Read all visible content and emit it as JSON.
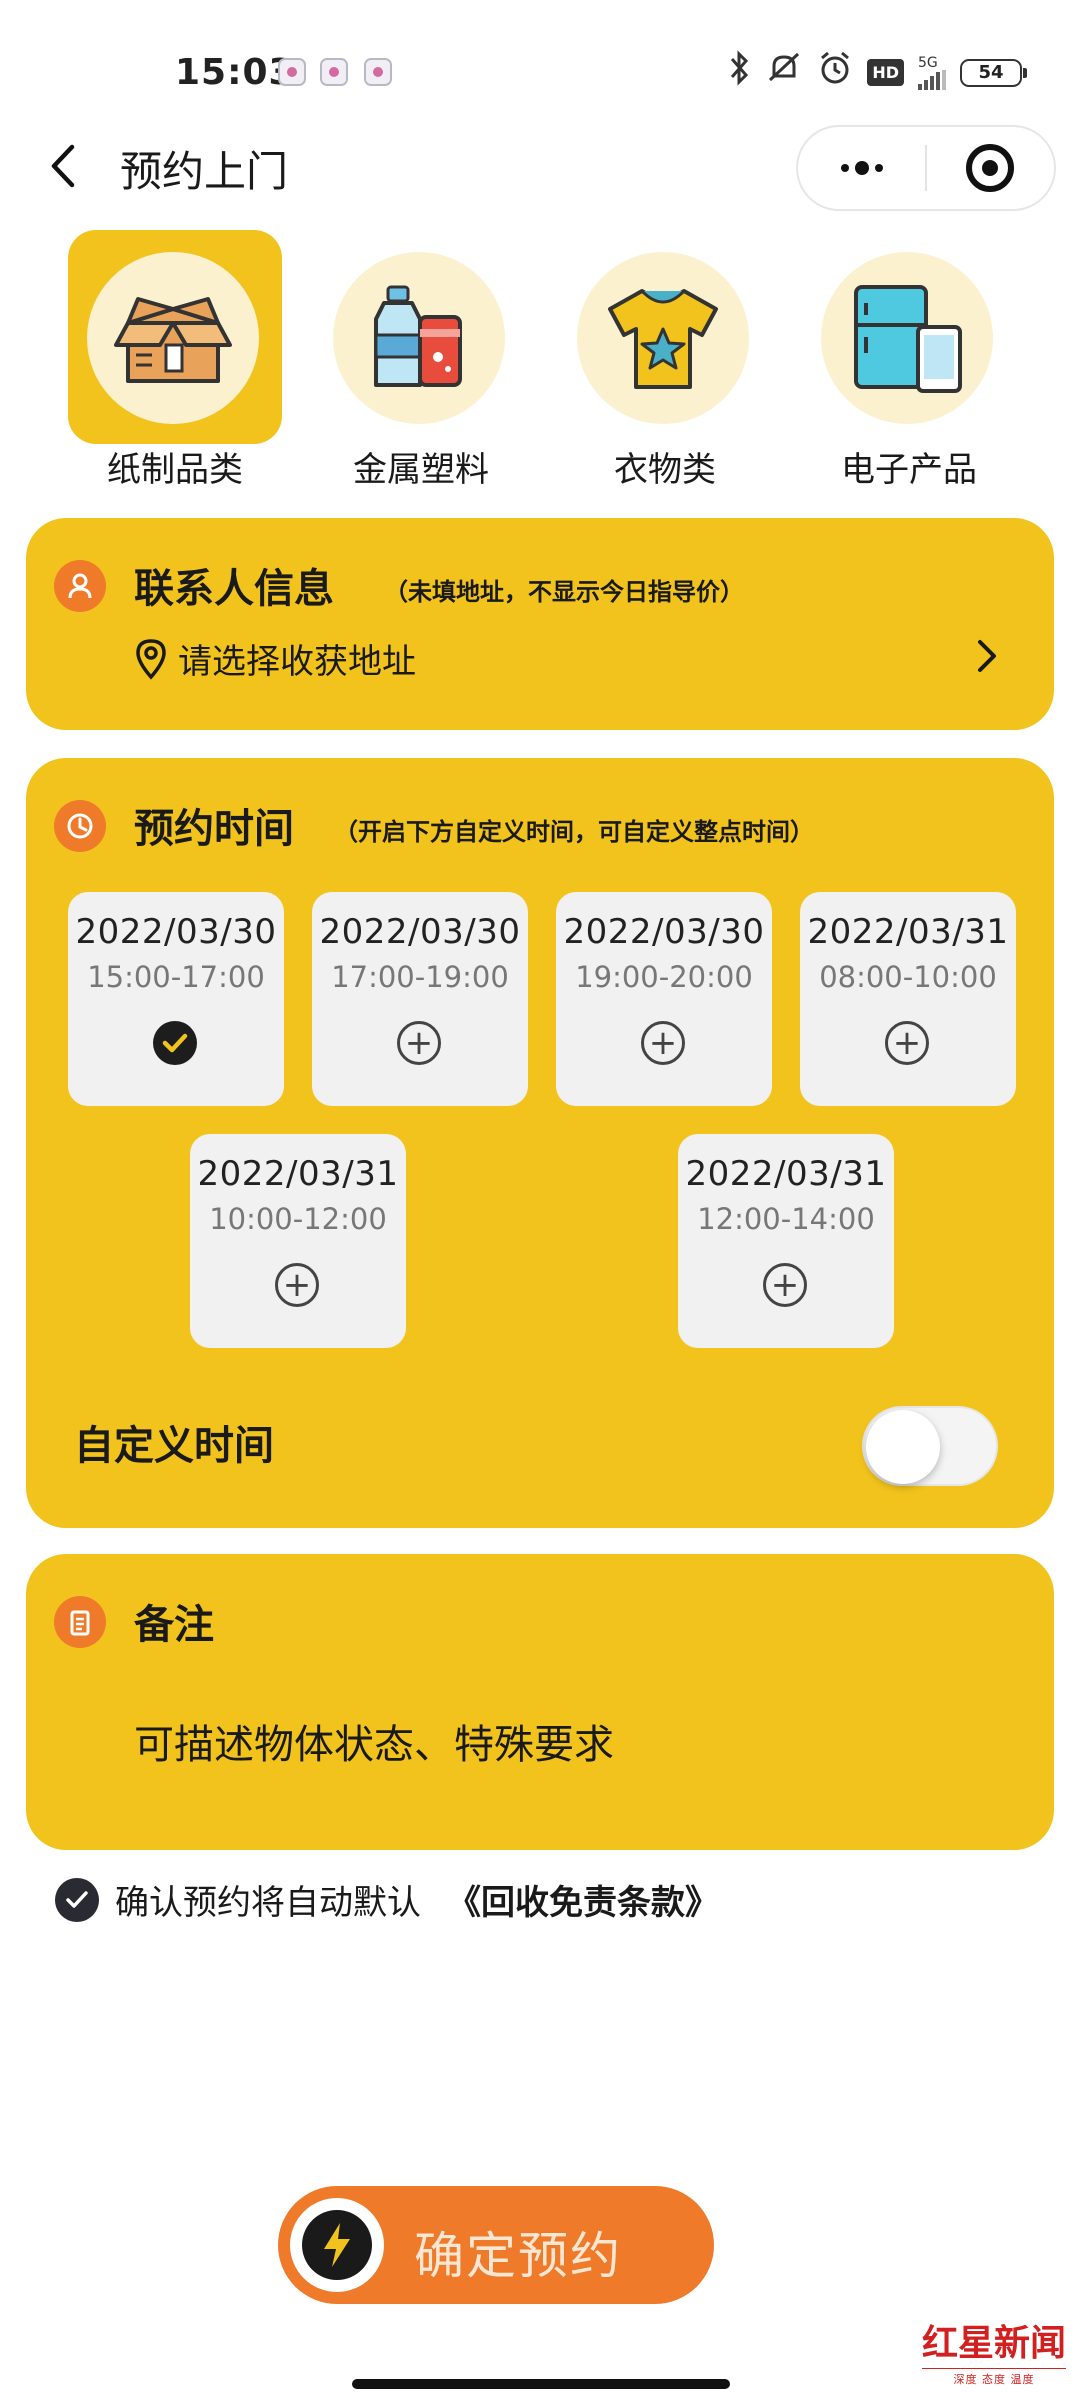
{
  "status_bar": {
    "time": "15:03",
    "network": "5G",
    "battery": "54"
  },
  "nav": {
    "title": "预约上门"
  },
  "categories": [
    {
      "label": "纸制品类",
      "icon": "box-icon",
      "active": true
    },
    {
      "label": "金属塑料",
      "icon": "bottle-can-icon",
      "active": false
    },
    {
      "label": "衣物类",
      "icon": "tshirt-icon",
      "active": false
    },
    {
      "label": "电子产品",
      "icon": "fridge-tablet-icon",
      "active": false
    }
  ],
  "contact": {
    "title": "联系人信息",
    "hint": "（未填地址，不显示今日指导价）",
    "address_placeholder": "请选择收获地址"
  },
  "schedule": {
    "title": "预约时间",
    "hint": "（开启下方自定义时间，可自定义整点时间）",
    "slots": [
      {
        "date": "2022/03/30",
        "time": "15:00-17:00",
        "selected": true
      },
      {
        "date": "2022/03/30",
        "time": "17:00-19:00",
        "selected": false
      },
      {
        "date": "2022/03/30",
        "time": "19:00-20:00",
        "selected": false
      },
      {
        "date": "2022/03/31",
        "time": "08:00-10:00",
        "selected": false
      },
      {
        "date": "2022/03/31",
        "time": "10:00-12:00",
        "selected": false
      },
      {
        "date": "2022/03/31",
        "time": "12:00-14:00",
        "selected": false
      }
    ],
    "custom_time_label": "自定义时间",
    "custom_time_enabled": false
  },
  "remark": {
    "title": "备注",
    "placeholder": "可描述物体状态、特殊要求"
  },
  "agreement": {
    "text": "确认预约将自动默认",
    "link": "《回收免责条款》",
    "checked": true
  },
  "confirm": {
    "label": "确定预约"
  },
  "watermark": {
    "main": "红星新闻",
    "sub": "深度 态度 温度"
  },
  "colors": {
    "card": "#f2c31c",
    "accent": "#ee7a2a",
    "slot_bg": "#f1f1f2"
  }
}
